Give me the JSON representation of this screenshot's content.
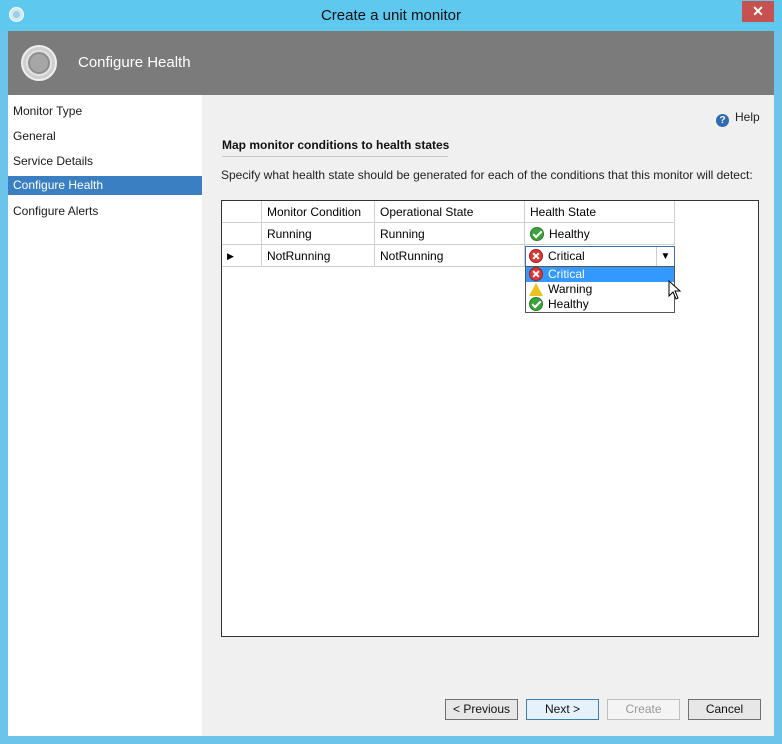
{
  "window": {
    "title": "Create a unit monitor",
    "close_glyph": "✕"
  },
  "banner": {
    "title": "Configure Health",
    "icon": "wizard-ring-icon"
  },
  "sidebar": {
    "items": [
      {
        "label": "Monitor Type"
      },
      {
        "label": "General"
      },
      {
        "label": "Service Details"
      },
      {
        "label": "Configure Health",
        "active": true
      },
      {
        "label": "Configure Alerts"
      }
    ]
  },
  "main": {
    "help_label": "Help",
    "section_title": "Map monitor conditions to health states",
    "description": "Specify what health state should be generated for each of the conditions that this monitor will detect:",
    "grid": {
      "headers": [
        "Monitor Condition",
        "Operational State",
        "Health State"
      ],
      "rows": [
        {
          "condition": "Running",
          "operational_state": "Running",
          "health_state": "Healthy",
          "icon": "healthy-icon"
        },
        {
          "condition": "NotRunning",
          "operational_state": "NotRunning",
          "health_state": "Critical",
          "icon": "critical-icon"
        }
      ],
      "current_row_marker": "▶",
      "dropdown_options": [
        {
          "label": "Critical",
          "icon": "critical-icon",
          "selected": true
        },
        {
          "label": "Warning",
          "icon": "warning-icon"
        },
        {
          "label": "Healthy",
          "icon": "healthy-icon"
        }
      ]
    }
  },
  "buttons": {
    "previous": "< Previous",
    "next": "Next >",
    "create": "Create",
    "cancel": "Cancel"
  },
  "colors": {
    "titlebar": "#5ec8ef",
    "banner": "#7b7b7b",
    "selection": "#3a7fc1",
    "close": "#c75050"
  }
}
